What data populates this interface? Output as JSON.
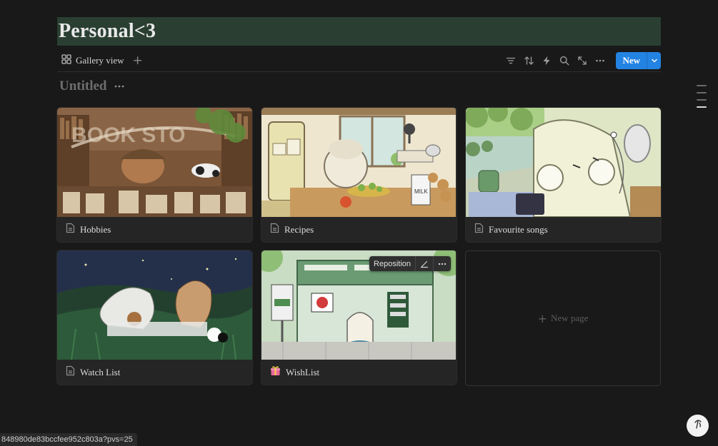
{
  "page": {
    "title": "Personal<3"
  },
  "toolbar": {
    "view_label": "Gallery view",
    "add_view_symbol": "+",
    "tools": [
      "filter-icon",
      "sort-icon",
      "automation-icon",
      "search-icon",
      "expand-icon",
      "more-icon"
    ],
    "new_label": "New"
  },
  "group": {
    "title": "Untitled"
  },
  "cards": [
    {
      "title": "Hobbies",
      "icon": "page-icon",
      "cover_theme": "bookstore"
    },
    {
      "title": "Recipes",
      "icon": "page-icon",
      "cover_theme": "kitchen"
    },
    {
      "title": "Favourite songs",
      "icon": "page-icon",
      "cover_theme": "music"
    },
    {
      "title": "Watch List",
      "icon": "page-icon",
      "cover_theme": "night-meadow"
    },
    {
      "title": "WishList",
      "icon": "gift-emoji",
      "cover_theme": "bus-stop"
    }
  ],
  "cover_actions": {
    "reposition_label": "Reposition"
  },
  "new_page": {
    "label": "New page"
  },
  "status_bar": {
    "url": "848980de83bccfee952c803a?pvs=25"
  },
  "colors": {
    "background": "#191919",
    "title_band": "#2a3f32",
    "accent": "#2383e2",
    "card": "#252525"
  }
}
